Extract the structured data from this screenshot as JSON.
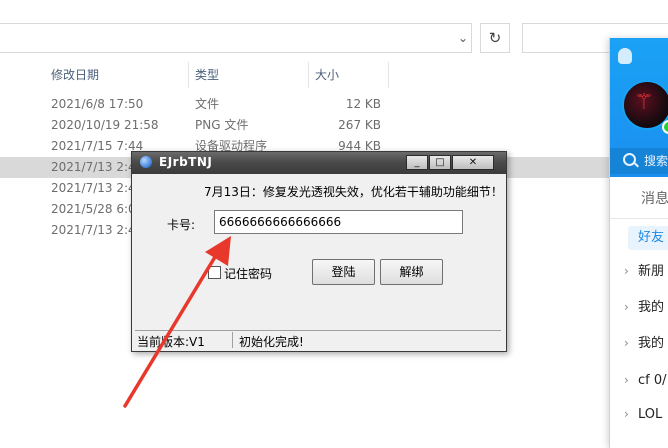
{
  "explorer": {
    "columns": {
      "date": "修改日期",
      "type": "类型",
      "size": "大小"
    },
    "rows": [
      {
        "date": "2021/6/8 17:50",
        "type": "文件",
        "size": "12 KB"
      },
      {
        "date": "2020/10/19 21:58",
        "type": "PNG 文件",
        "size": "267 KB"
      },
      {
        "date": "2021/7/15 7:44",
        "type": "设备驱动程序",
        "size": "944 KB"
      },
      {
        "date": "2021/7/13 2:4",
        "type": "",
        "size": ""
      },
      {
        "date": "2021/7/13 2:4",
        "type": "",
        "size": ""
      },
      {
        "date": "2021/5/28 6:0",
        "type": "",
        "size": ""
      },
      {
        "date": "2021/7/13 2:4",
        "type": "",
        "size": ""
      }
    ]
  },
  "qq": {
    "search_label": "搜索",
    "tab_messages": "消息",
    "tab_friends": "好友",
    "groups": [
      "新朋",
      "我的",
      "我的",
      "cf 0/",
      "LOL"
    ]
  },
  "dialog": {
    "title": "EJrbTNJ",
    "notice": "7月13日：修复发光透视失效，优化若干辅助功能细节！",
    "card_label": "卡号:",
    "card_value": "6666666666666666",
    "remember_label": "记住密码",
    "login_button": "登陆",
    "unbind_button": "解绑",
    "status_version": "当前版本:V1",
    "status_message": "初始化完成!",
    "buttons": {
      "minimize": "_",
      "maximize": "□",
      "close": "✕"
    }
  },
  "colors": {
    "annotation_arrow": "#e8382c",
    "qq_blue": "#1b8ff0"
  }
}
